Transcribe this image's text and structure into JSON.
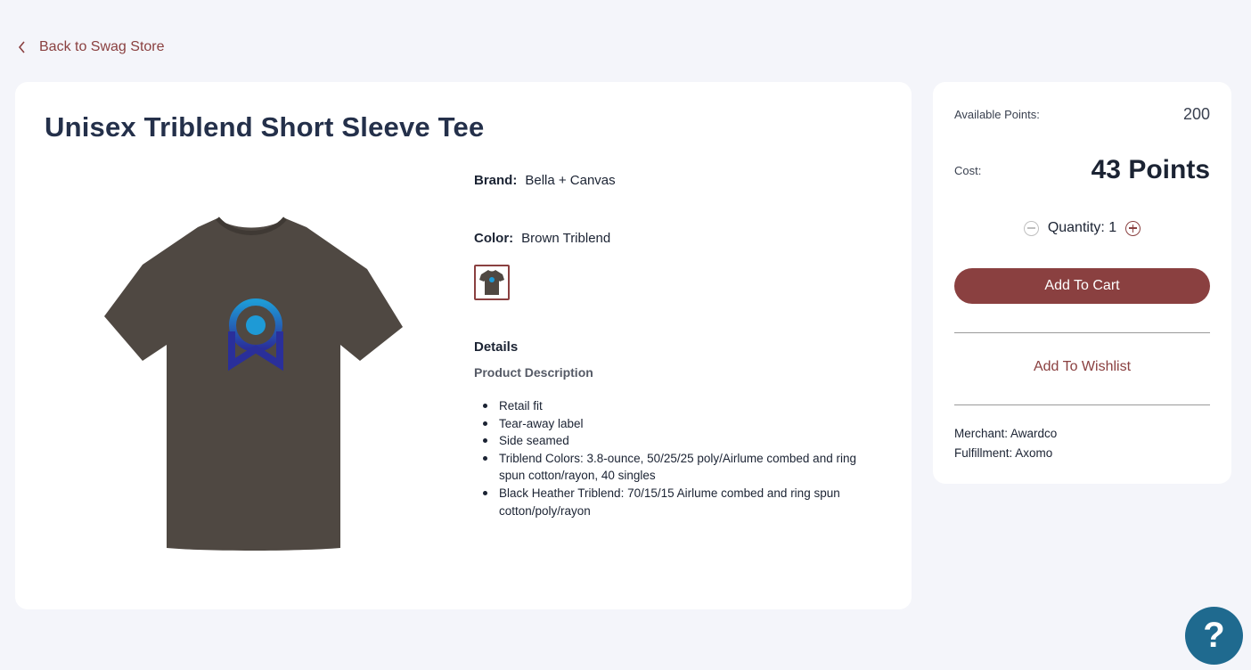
{
  "nav": {
    "back_label": "Back to Swag Store"
  },
  "product": {
    "title": "Unisex Triblend Short Sleeve Tee",
    "brand_label": "Brand:",
    "brand": "Bella + Canvas",
    "color_label": "Color:",
    "color": "Brown Triblend",
    "details_heading": "Details",
    "description_heading": "Product Description",
    "features": [
      "Retail fit",
      "Tear-away label",
      "Side seamed",
      "Triblend Colors: 3.8-ounce, 50/25/25 poly/Airlume combed and ring spun cotton/rayon, 40 singles",
      "Black Heather Triblend: 70/15/15 Airlume combed and ring spun cotton/poly/rayon"
    ]
  },
  "purchase": {
    "available_points_label": "Available Points:",
    "available_points": "200",
    "cost_label": "Cost:",
    "cost": "43 Points",
    "quantity_label": "Quantity: 1",
    "add_to_cart": "Add To Cart",
    "add_to_wishlist": "Add To Wishlist",
    "merchant": "Merchant: Awardco",
    "fulfillment": "Fulfillment: Axomo"
  },
  "help": {
    "label": "?"
  },
  "colors": {
    "accent": "#8a4040",
    "shirt": "#4f4842",
    "help_button": "#1f6a8f"
  }
}
